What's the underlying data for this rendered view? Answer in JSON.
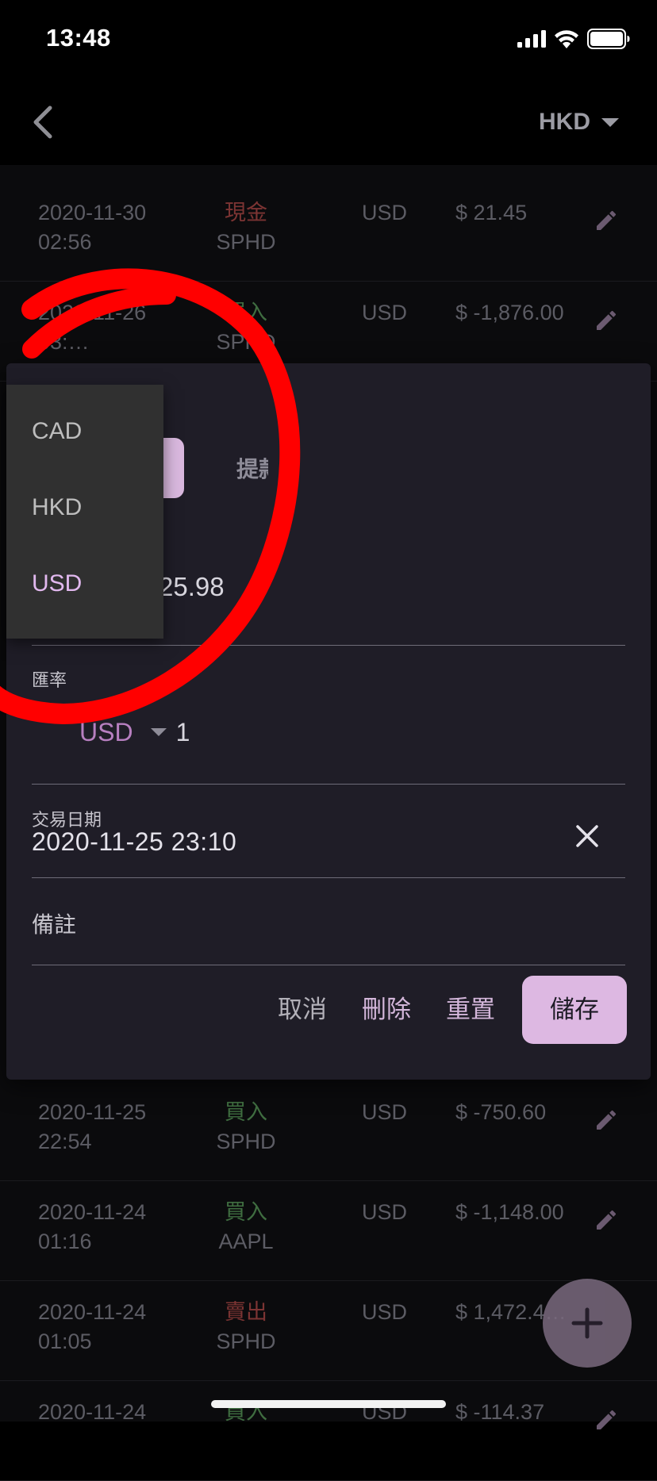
{
  "status_bar": {
    "time": "13:48"
  },
  "app_bar": {
    "currency": "HKD"
  },
  "transactions": [
    {
      "date": "2020-11-30",
      "time": "02:56",
      "type": "現金",
      "type_color": "red",
      "symbol": "SPHD",
      "currency": "USD",
      "amount": "$ 21.45"
    },
    {
      "date": "2020-11-26",
      "time": "03:…",
      "type": "買入",
      "type_color": "green",
      "symbol": "SPHD",
      "currency": "USD",
      "amount": "$ -1,876.00"
    },
    {
      "date": "2020-11-25",
      "time": "22:54",
      "type": "買入",
      "type_color": "green",
      "symbol": "SPHD",
      "currency": "USD",
      "amount": "$ -750.60"
    },
    {
      "date": "2020-11-24",
      "time": "01:16",
      "type": "買入",
      "type_color": "green",
      "symbol": "AAPL",
      "currency": "USD",
      "amount": "$ -1,148.00"
    },
    {
      "date": "2020-11-24",
      "time": "01:05",
      "type": "賣出",
      "type_color": "red",
      "symbol": "SPHD",
      "currency": "USD",
      "amount": "$ 1,472.4…"
    },
    {
      "date": "2020-11-24",
      "time": "",
      "type": "買入",
      "type_color": "green",
      "symbol": "",
      "currency": "USD",
      "amount": "$ -114.37"
    }
  ],
  "dialog": {
    "tab_withdraw": "提款",
    "amount_value": "25.98",
    "rate_label": "匯率",
    "rate_currency": "USD",
    "rate_value": "1",
    "date_label": "交易日期",
    "date_value": "2020-11-25 23:10",
    "note_label": "備註",
    "actions": {
      "cancel": "取消",
      "delete": "刪除",
      "reset": "重置",
      "save": "儲存"
    }
  },
  "currency_menu": {
    "options": [
      "CAD",
      "HKD",
      "USD"
    ],
    "selected": "USD"
  },
  "colors": {
    "accent": "#ddb8e2",
    "buy": "#3f6d40",
    "sell": "#7c3433",
    "annotation": "#ff0000"
  }
}
